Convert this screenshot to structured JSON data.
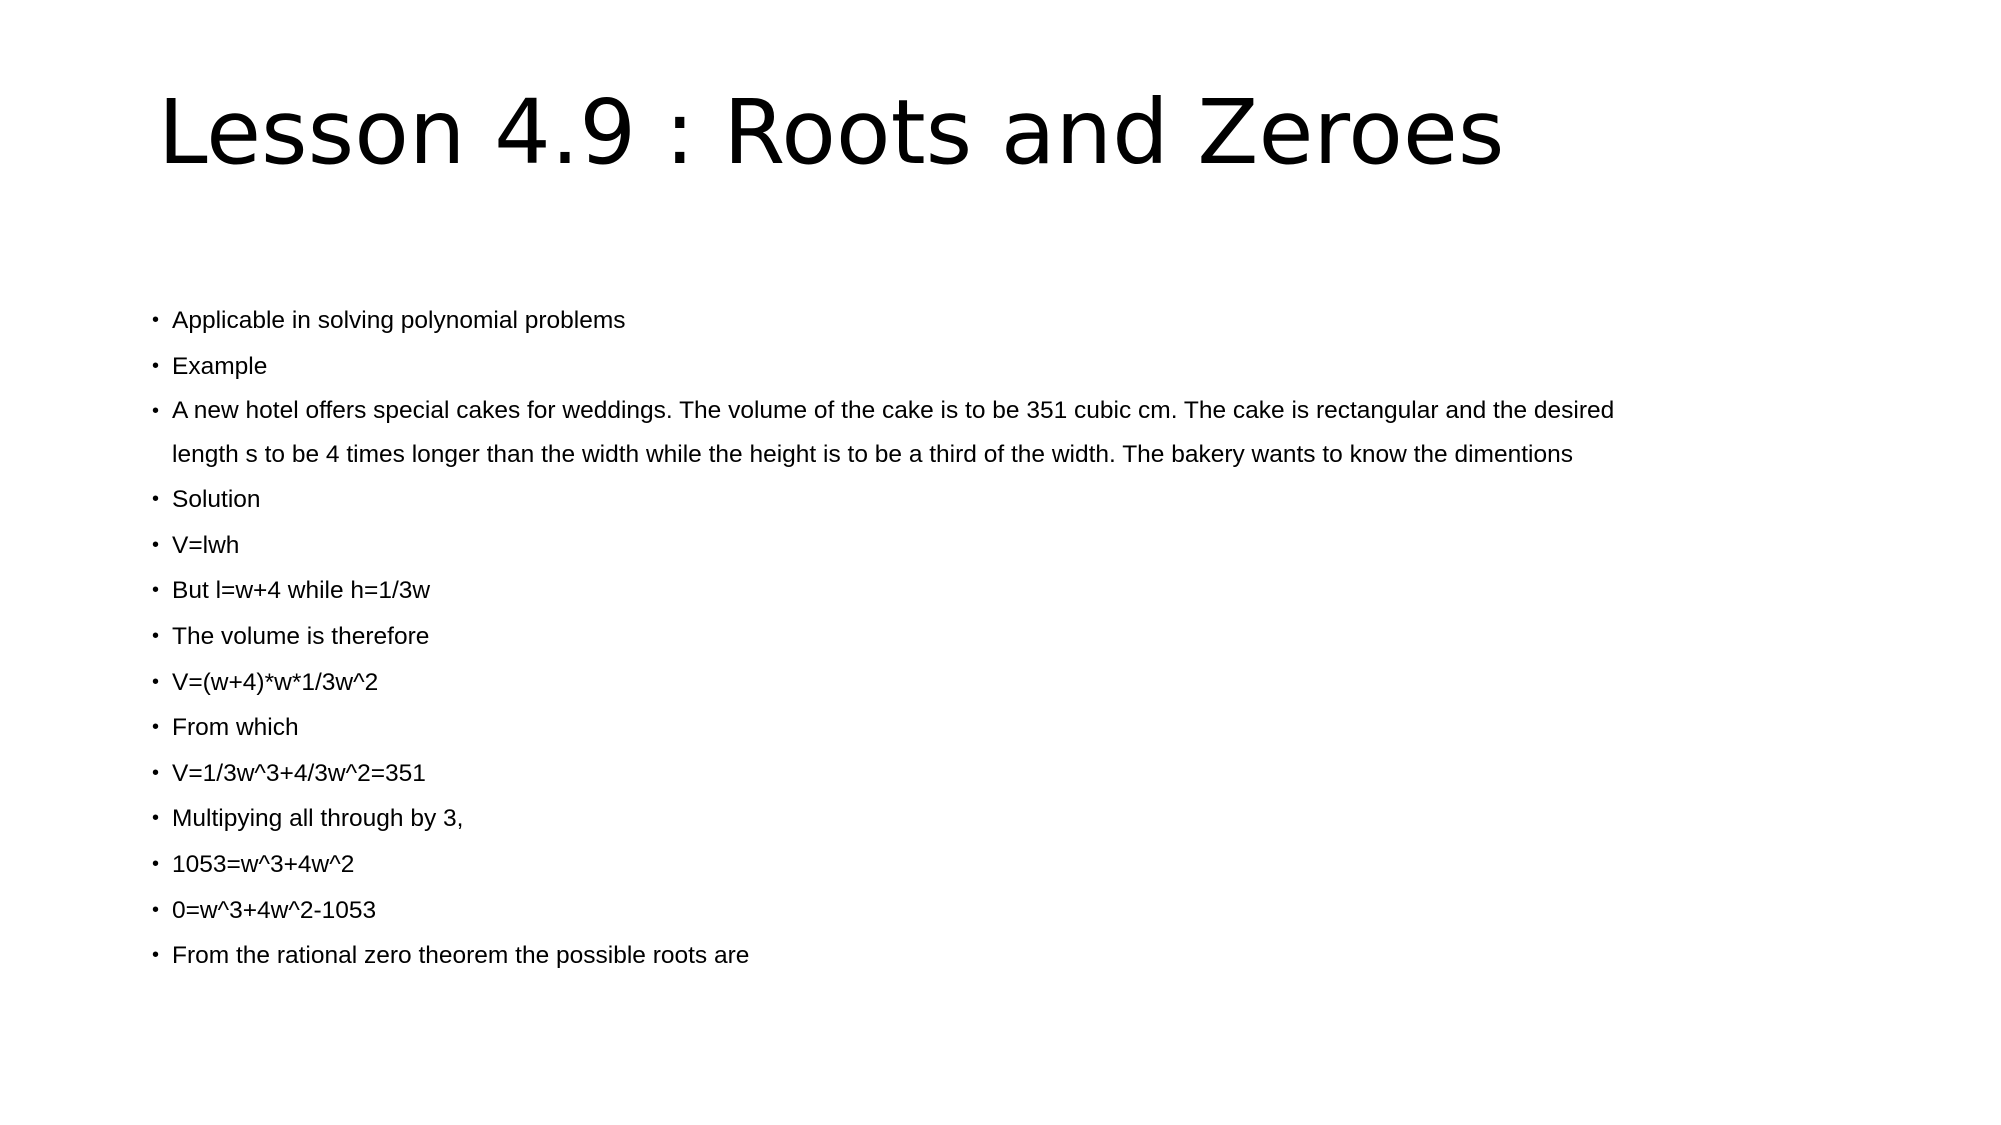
{
  "slide": {
    "background_color": "#ffffff",
    "text_color": "#000000",
    "title": "Lesson 4.9 : Roots and Zeroes",
    "bullets": [
      {
        "id": "bullet-applicable",
        "text": "Applicable in solving polynomial problems",
        "wraps": false
      },
      {
        "id": "bullet-example",
        "text": "Example",
        "wraps": false
      },
      {
        "id": "bullet-problem-statement",
        "text": "A new hotel offers special cakes for weddings. The volume of the cake is to be 351 cubic cm. The cake is rectangular and the desired length s to be 4 times longer than the width while the height is to be a third of the width. The bakery wants to know the dimentions",
        "line1": "A new hotel offers special cakes for weddings. The volume of the cake is to be 351 cubic cm. The cake is rectangular and the desired",
        "line2": "length s to be 4 times longer than the width while the height is to be a third of the width. The bakery wants to know the dimentions",
        "wraps": true
      },
      {
        "id": "bullet-solution",
        "text": "Solution",
        "wraps": false
      },
      {
        "id": "bullet-volume-formula",
        "text": "V=lwh",
        "wraps": false
      },
      {
        "id": "bullet-substitutions",
        "text": "But l=w+4 while h=1/3w",
        "wraps": false
      },
      {
        "id": "bullet-volume-is-therefore",
        "text": "The volume is therefore",
        "wraps": false
      },
      {
        "id": "bullet-volume-expanded",
        "text": "V=(w+4)*w*1/3w^2",
        "wraps": false
      },
      {
        "id": "bullet-from-which",
        "text": "From which",
        "wraps": false
      },
      {
        "id": "bullet-volume-cubic",
        "text": "V=1/3w^3+4/3w^2=351",
        "wraps": false
      },
      {
        "id": "bullet-multiply-by-3",
        "text": "Multipying all through by 3,",
        "wraps": false
      },
      {
        "id": "bullet-1053-equation",
        "text": "1053=w^3+4w^2",
        "wraps": false
      },
      {
        "id": "bullet-zero-equation",
        "text": "0=w^3+4w^2-1053",
        "wraps": false
      },
      {
        "id": "bullet-rational-zero-theorem",
        "text": "From the rational zero theorem the possible roots are",
        "wraps": false
      }
    ]
  }
}
